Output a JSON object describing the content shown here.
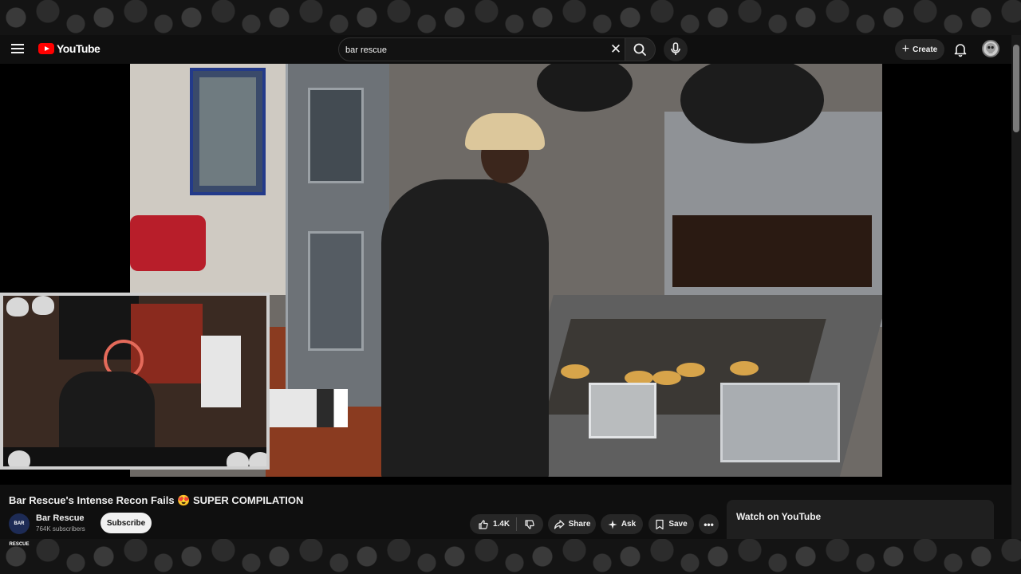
{
  "masthead": {
    "logo_text": "YouTube",
    "search": {
      "value": "bar rescue",
      "placeholder": "Search"
    },
    "create_label": "Create"
  },
  "video": {
    "title": "Bar Rescue's Intense Recon Fails 😍 SUPER COMPILATION"
  },
  "channel": {
    "name": "Bar Rescue",
    "subscribers": "764K subscribers",
    "avatar_text": "BAR RESCUE"
  },
  "actions": {
    "subscribe_label": "Subscribe",
    "like_count": "1.4K",
    "share_label": "Share",
    "ask_label": "Ask",
    "save_label": "Save"
  },
  "watch_on_youtube": "Watch on YouTube",
  "colors": {
    "brand_red": "#ff0000",
    "page_bg": "#0f0f0f",
    "pill_bg": "#272727",
    "subscribe_bg": "#f1f1f1"
  },
  "icons": [
    "menu-icon",
    "youtube-logo-icon",
    "close-icon",
    "search-icon",
    "mic-icon",
    "plus-icon",
    "bell-icon",
    "like-icon",
    "dislike-icon",
    "share-icon",
    "sparkle-icon",
    "save-icon",
    "more-icon"
  ]
}
